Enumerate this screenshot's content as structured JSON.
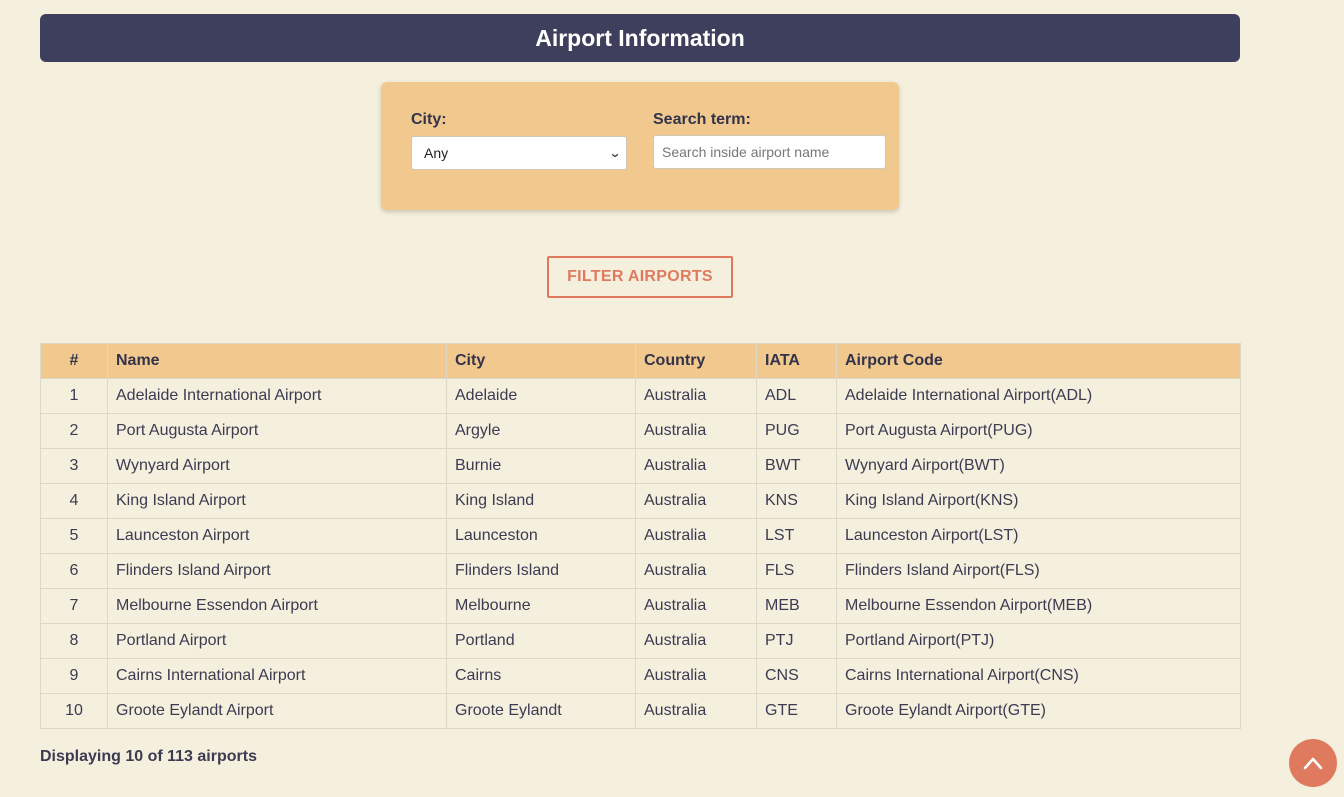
{
  "header": {
    "title": "Airport Information"
  },
  "filters": {
    "city_label": "City:",
    "city_selected": "Any",
    "search_label": "Search term:",
    "search_placeholder": "Search inside airport name",
    "search_value": ""
  },
  "filter_button": {
    "label": "FILTER AIRPORTS"
  },
  "table": {
    "columns": [
      "#",
      "Name",
      "City",
      "Country",
      "IATA",
      "Airport Code"
    ],
    "rows": [
      [
        "1",
        "Adelaide International Airport",
        "Adelaide",
        "Australia",
        "ADL",
        "Adelaide International Airport(ADL)"
      ],
      [
        "2",
        "Port Augusta Airport",
        "Argyle",
        "Australia",
        "PUG",
        "Port Augusta Airport(PUG)"
      ],
      [
        "3",
        "Wynyard Airport",
        "Burnie",
        "Australia",
        "BWT",
        "Wynyard Airport(BWT)"
      ],
      [
        "4",
        "King Island Airport",
        "King Island",
        "Australia",
        "KNS",
        "King Island Airport(KNS)"
      ],
      [
        "5",
        "Launceston Airport",
        "Launceston",
        "Australia",
        "LST",
        "Launceston Airport(LST)"
      ],
      [
        "6",
        "Flinders Island Airport",
        "Flinders Island",
        "Australia",
        "FLS",
        "Flinders Island Airport(FLS)"
      ],
      [
        "7",
        "Melbourne Essendon Airport",
        "Melbourne",
        "Australia",
        "MEB",
        "Melbourne Essendon Airport(MEB)"
      ],
      [
        "8",
        "Portland Airport",
        "Portland",
        "Australia",
        "PTJ",
        "Portland Airport(PTJ)"
      ],
      [
        "9",
        "Cairns International Airport",
        "Cairns",
        "Australia",
        "CNS",
        "Cairns International Airport(CNS)"
      ],
      [
        "10",
        "Groote Eylandt Airport",
        "Groote Eylandt",
        "Australia",
        "GTE",
        "Groote Eylandt Airport(GTE)"
      ]
    ]
  },
  "footer": {
    "summary": "Displaying 10 of 113 airports"
  },
  "icons": {
    "select_arrow": "chevron-down-icon",
    "scroll_top": "chevron-up-icon"
  },
  "colors": {
    "background": "#f5efdd",
    "header_bg": "#3d3f5c",
    "panel_bg": "#f1c98f",
    "accent": "#e07a5f"
  }
}
